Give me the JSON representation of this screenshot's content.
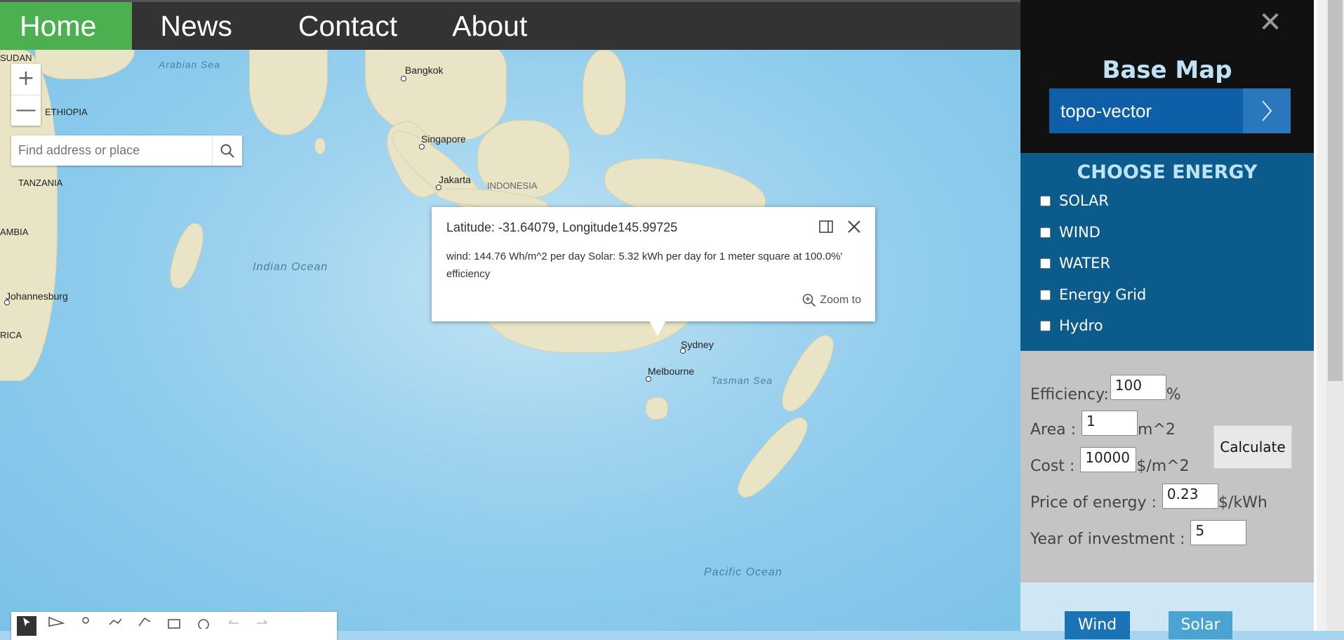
{
  "nav": {
    "items": [
      "Home",
      "News",
      "Contact",
      "About"
    ],
    "active": "Home",
    "active_color": "#4caf50"
  },
  "map": {
    "zoom_in": "+",
    "zoom_out": "—",
    "search_placeholder": "Find address or place",
    "labels": {
      "sudan": "SUDAN",
      "ethiopia": "ETHIOPIA",
      "tanzania": "TANZANIA",
      "zambia": "AMBIA",
      "africa": "RICA",
      "indonesia": "INDONESIA",
      "bangkok": "Bangkok",
      "singapore": "Singapore",
      "jakarta": "Jakarta",
      "johannesburg": "Johannesburg",
      "sydney": "Sydney",
      "melbourne": "Melbourne",
      "arabian_sea": "Arabian Sea",
      "indian_ocean": "Indian Ocean",
      "tasman_sea": "Tasman Sea",
      "pacific_ocean": "Pacific Ocean"
    }
  },
  "popup": {
    "title": "Latitude: -31.64079, Longitude145.99725",
    "body": "wind: 144.76 Wh/m^2 per day Solar: 5.32 kWh per day for 1 meter square at 100.0%' efficiency",
    "zoom_to": "Zoom to"
  },
  "panel": {
    "close": "✕",
    "basemap_title": "Base Map",
    "basemap_value": "topo-vector",
    "energy_title": "CHOOSE ENERGY",
    "energy_options": [
      "SOLAR",
      "WIND",
      "WATER",
      "Energy Grid",
      "Hydro"
    ],
    "fields": {
      "efficiency": {
        "label": "Efficiency:",
        "value": "100",
        "unit": "%"
      },
      "area": {
        "label": "Area :",
        "value": "1",
        "unit": "m^2"
      },
      "cost": {
        "label": "Cost :",
        "value": "10000",
        "unit": "$/m^2"
      },
      "price": {
        "label": "Price of energy :",
        "value": "0.23",
        "unit": "$/kWh"
      },
      "years": {
        "label": "Year of investment :",
        "value": "5",
        "unit": ""
      }
    },
    "calculate": "Calculate",
    "bottom_buttons": [
      "Wind",
      "Solar"
    ]
  },
  "colors": {
    "nav_bg": "#333333",
    "panel_dark": "#111111",
    "basemap_blue": "#0f5fa8",
    "energy_blue": "#0c5b8d",
    "calc_grey": "#c4c4c4",
    "wind_btn": "#1a73b5",
    "solar_btn": "#4aa3d1"
  }
}
